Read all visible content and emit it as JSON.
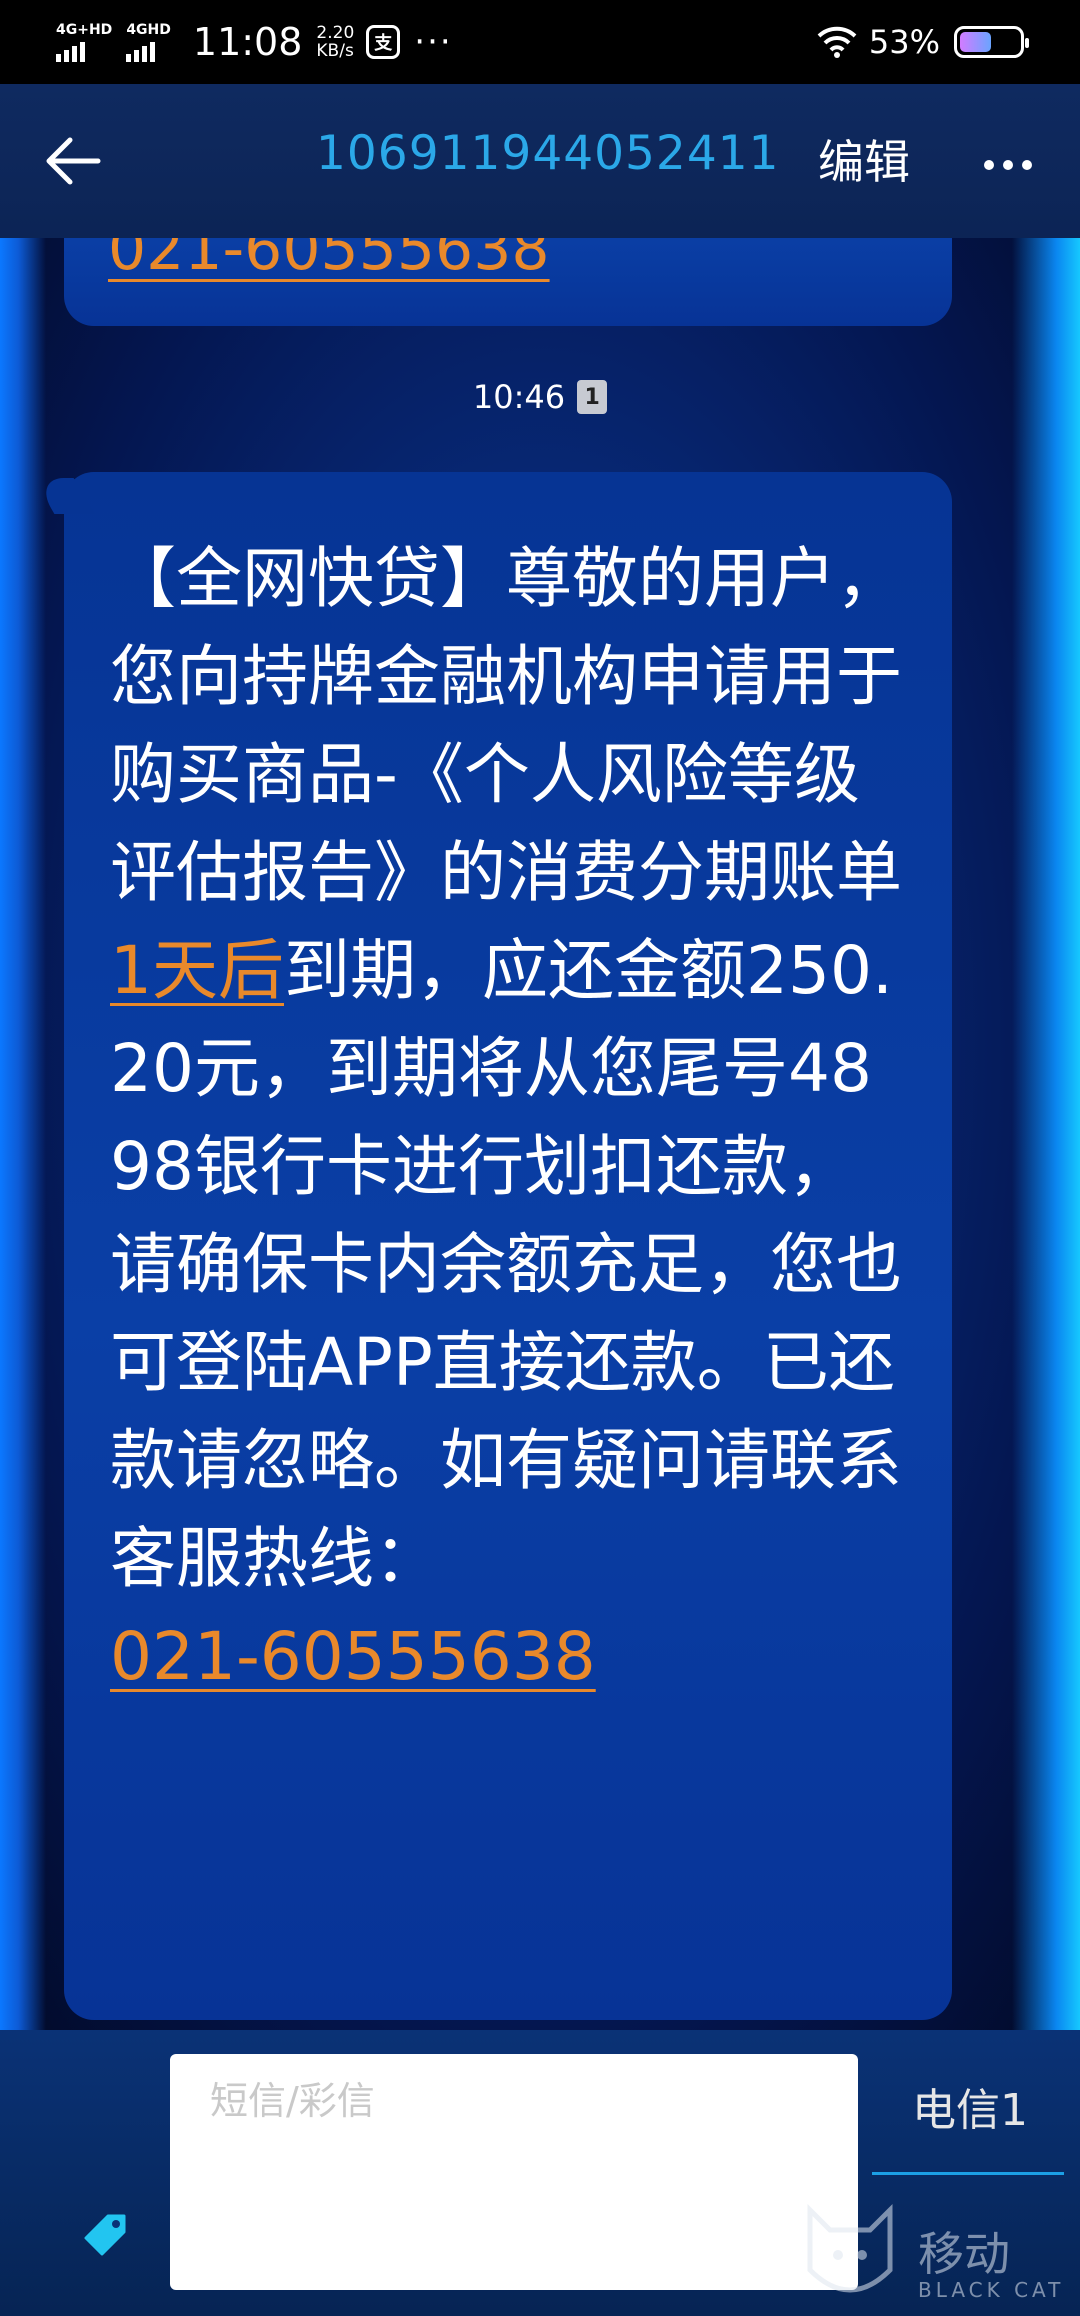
{
  "status_bar": {
    "signal1": "4G+HD",
    "signal2": "4GHD",
    "time": "11:08",
    "speed_value": "2.20",
    "speed_unit": "KB/s",
    "app_icon": "支",
    "more": "···",
    "battery": "53%",
    "battery_level": 0.53
  },
  "header": {
    "contact": "106911944052411",
    "edit_label": "编辑"
  },
  "chat": {
    "prev_link": "021-60555638",
    "timestamp": "10:46",
    "sim_badge": "1",
    "message": {
      "part1": "【全网快贷】尊敬的用户，您向持牌金融机构申请用于购买商品-《个人风险等级评估报告》的消费分期账单",
      "link1": "1天后",
      "part2": "到期，应还金额250.20元，到期将从您尾号4898银行卡进行划扣还款，请确保卡内余额充足，您也可登陆APP直接还款。已还款请忽略。如有疑问请联系客服热线：",
      "link2": "021-60555638"
    }
  },
  "input": {
    "placeholder": "短信/彩信",
    "sim_label": "电信1"
  },
  "watermark": {
    "text": "移动",
    "sub": "BLACK CAT"
  },
  "colors": {
    "accent_link": "#e9892b",
    "contact": "#2ba8e8",
    "bubble": "#0a3fa6"
  },
  "icons": [
    "back-arrow-icon",
    "more-dots-icon",
    "wifi-icon",
    "battery-icon",
    "tag-icon",
    "sim-badge-icon"
  ]
}
